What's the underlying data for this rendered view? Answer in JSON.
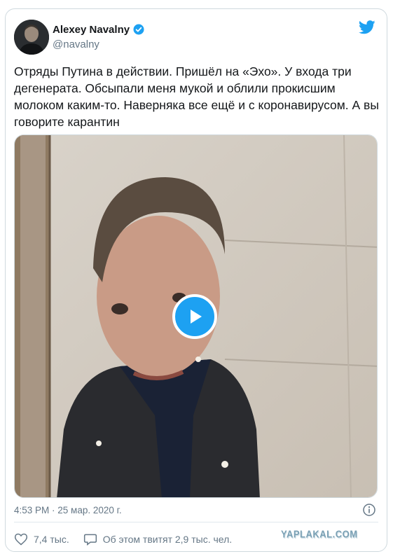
{
  "author": {
    "name": "Alexey Navalny",
    "handle": "@navalny",
    "verified": true
  },
  "tweet": {
    "text": "Отряды Путина в действии. Пришёл на «Эхо». У входа три дегенерата. Обсыпали меня мукой и облили прокисшим молоком каким-то. Наверняка все ещё и с коронавирусом. А вы говорите карантин"
  },
  "media": {
    "type": "video",
    "play_icon": "play-icon"
  },
  "meta": {
    "timestamp": "4:53 PM · 25 мар. 2020 г."
  },
  "actions": {
    "likes": "7,4 тыс.",
    "talking": "Об этом твитят 2,9 тыс. чел."
  },
  "watermark": "YAPLAKAL.COM",
  "colors": {
    "accent": "#1da1f2",
    "verified": "#1da1f2",
    "secondary_text": "#657786",
    "border": "#cfd9de"
  },
  "icons": [
    "twitter-bird-icon",
    "verified-badge-icon",
    "play-icon",
    "info-icon",
    "heart-icon",
    "comment-icon"
  ]
}
